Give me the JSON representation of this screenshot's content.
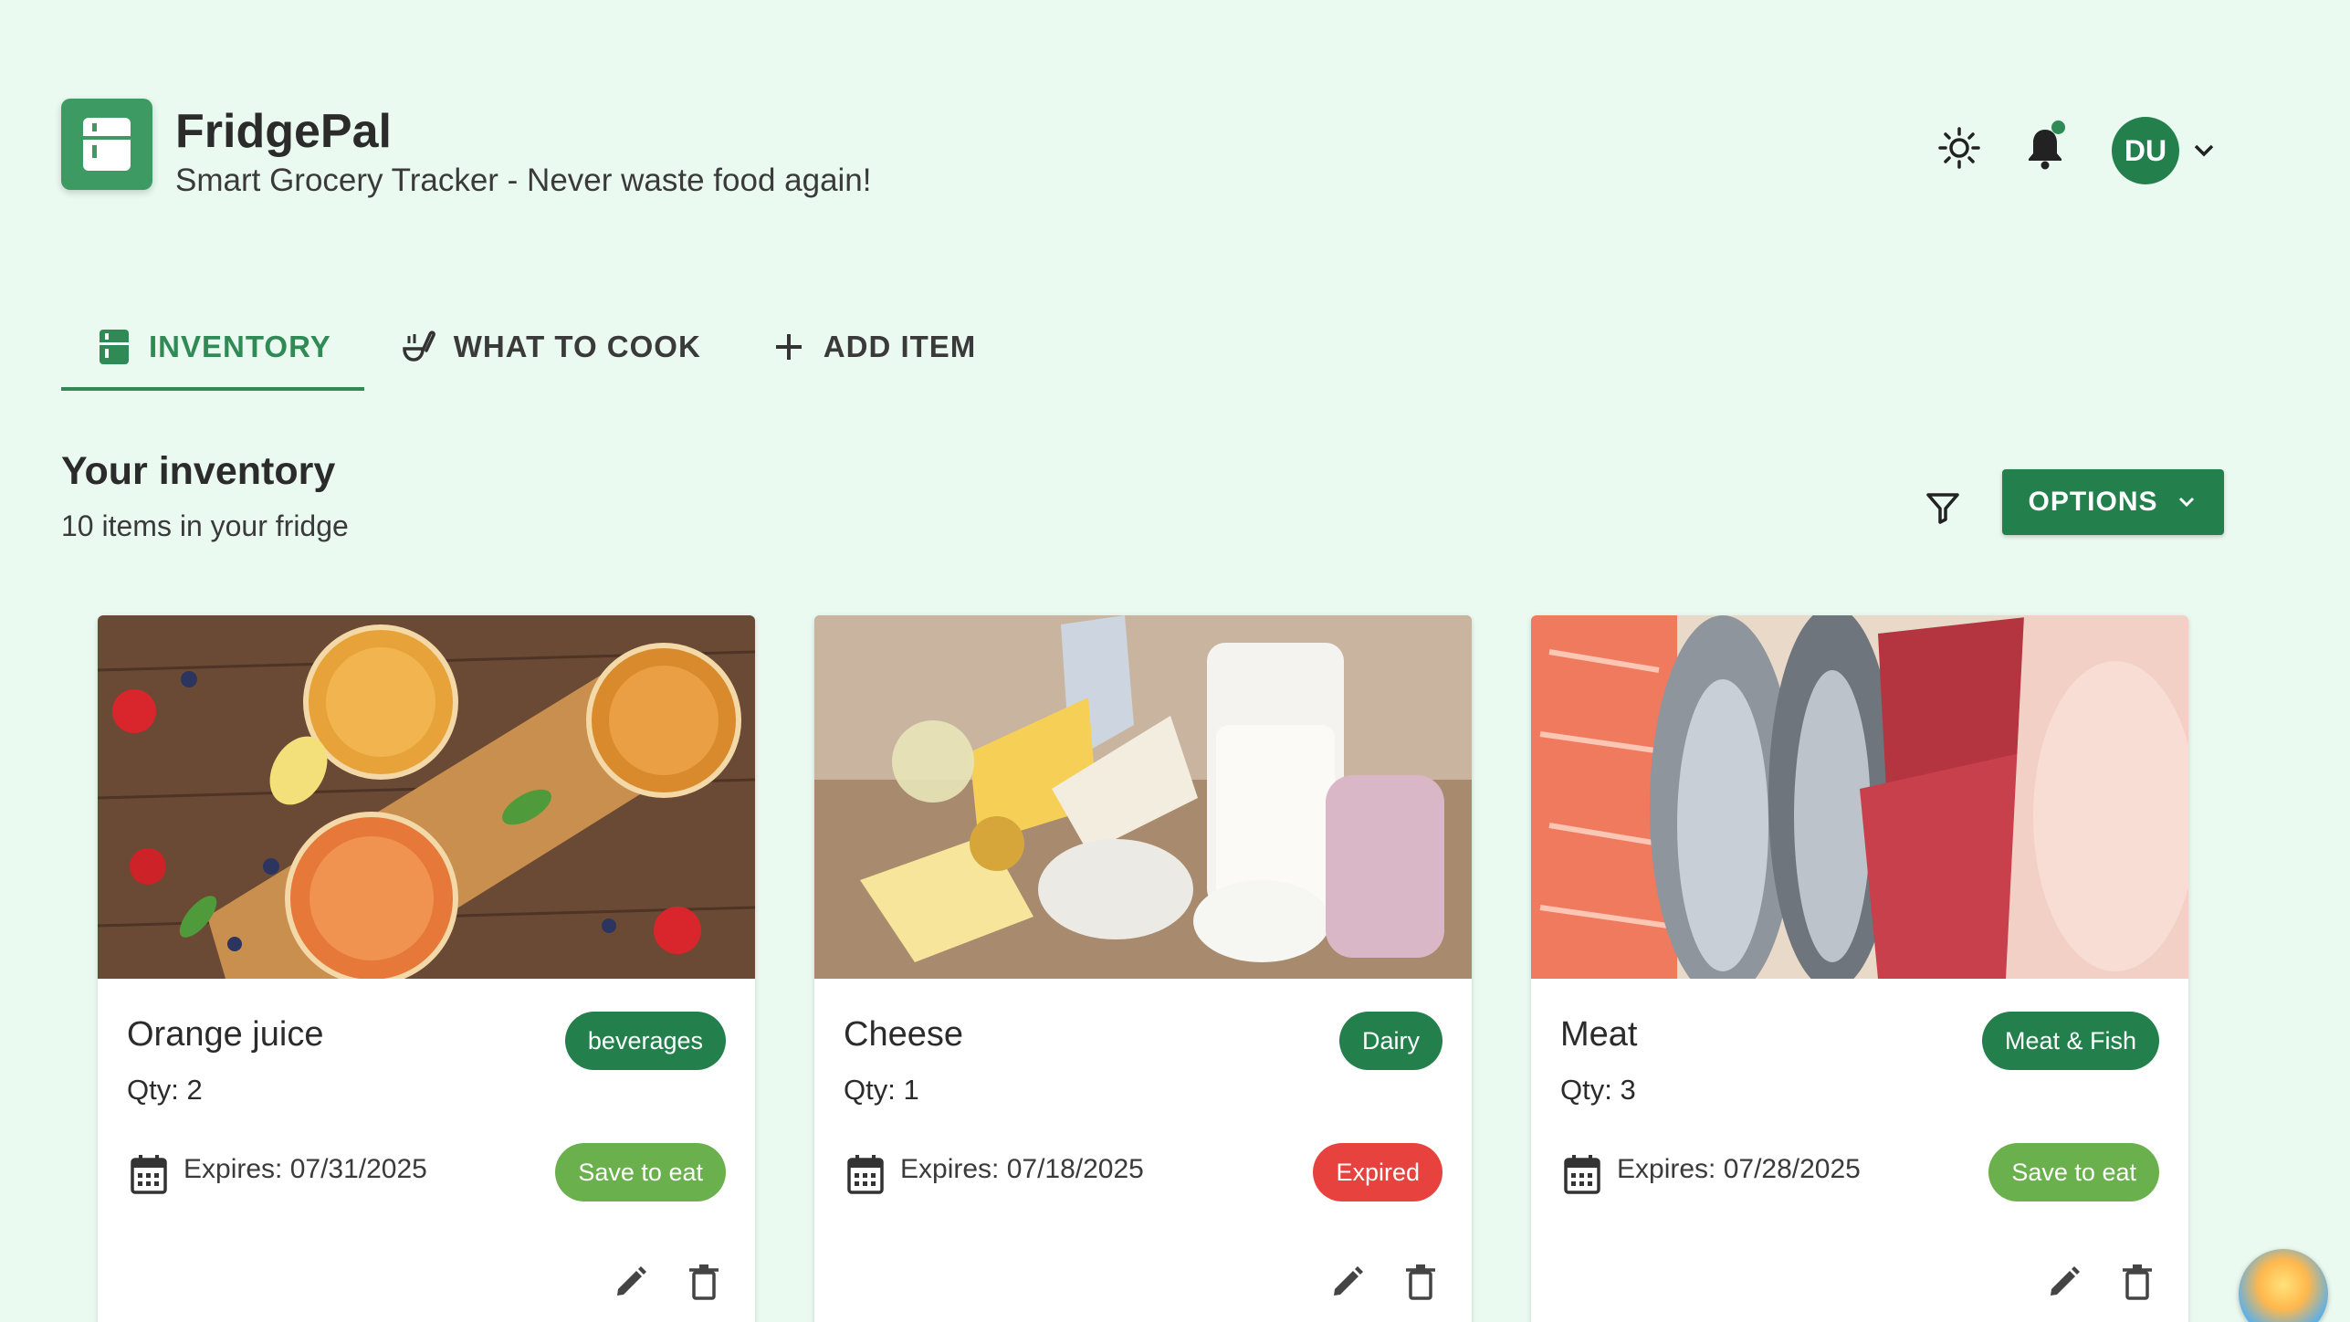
{
  "app": {
    "title": "FridgePal",
    "subtitle": "Smart Grocery Tracker - Never waste food again!",
    "user_initials": "DU",
    "accent": "#2f8a55"
  },
  "header_icons": [
    "sun-icon",
    "bell-icon",
    "chevron-down-icon"
  ],
  "tabs": [
    {
      "label": "INVENTORY",
      "icon": "fridge-icon",
      "active": true
    },
    {
      "label": "WHAT TO COOK",
      "icon": "ladle-icon",
      "active": false
    },
    {
      "label": "ADD ITEM",
      "icon": "plus-icon",
      "active": false
    }
  ],
  "inventory": {
    "title": "Your inventory",
    "subtitle": "10 items in your fridge",
    "options_label": "OPTIONS"
  },
  "items": [
    {
      "name": "Orange juice",
      "category": "beverages",
      "qty": "Qty: 2",
      "expires": "Expires: 07/31/2025",
      "status": "Save to eat",
      "status_color": "#6ab04c"
    },
    {
      "name": "Cheese",
      "category": "Dairy",
      "qty": "Qty: 1",
      "expires": "Expires: 07/18/2025",
      "status": "Expired",
      "status_color": "#e8423f"
    },
    {
      "name": "Meat",
      "category": "Meat & Fish",
      "qty": "Qty: 3",
      "expires": "Expires: 07/28/2025",
      "status": "Save to eat",
      "status_color": "#6ab04c"
    }
  ]
}
